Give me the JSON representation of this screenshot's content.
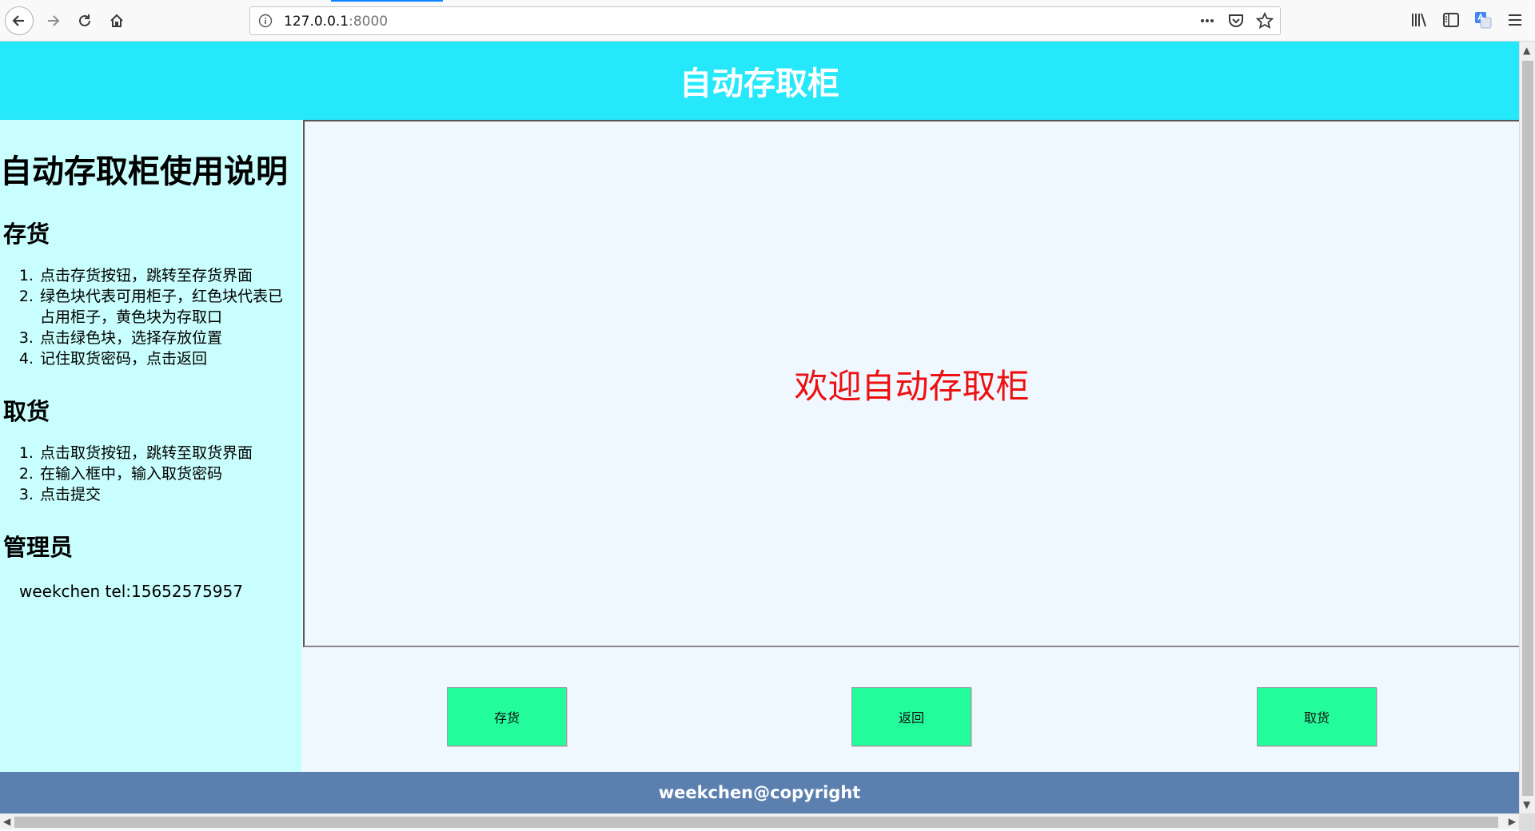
{
  "browser": {
    "url_host": "127.0.0.1",
    "url_port": ":8000"
  },
  "header": {
    "title": "自动存取柜"
  },
  "sidebar": {
    "title": "自动存取柜使用说明",
    "sections": [
      {
        "heading": "存货",
        "steps": [
          "点击存货按钮，跳转至存货界面",
          "绿色块代表可用柜子，红色块代表已占用柜子，黄色块为存取口",
          "点击绿色块，选择存放位置",
          "记住取货密码，点击返回"
        ]
      },
      {
        "heading": "取货",
        "steps": [
          "点击取货按钮，跳转至取货界面",
          "在输入框中，输入取货密码",
          "点击提交"
        ]
      },
      {
        "heading": "管理员",
        "text": "weekchen tel:15652575957"
      }
    ]
  },
  "main": {
    "welcome": "欢迎自动存取柜"
  },
  "buttons": {
    "store": "存货",
    "back": "返回",
    "retrieve": "取货"
  },
  "footer": {
    "text": "weekchen@copyright"
  },
  "colors": {
    "header_bg": "#25e8fa",
    "sidebar_bg": "#c8fefd",
    "content_bg": "#eff7ff",
    "button_bg": "#23fc9b",
    "footer_bg": "#5b80b0",
    "welcome_text": "#ee1010"
  }
}
